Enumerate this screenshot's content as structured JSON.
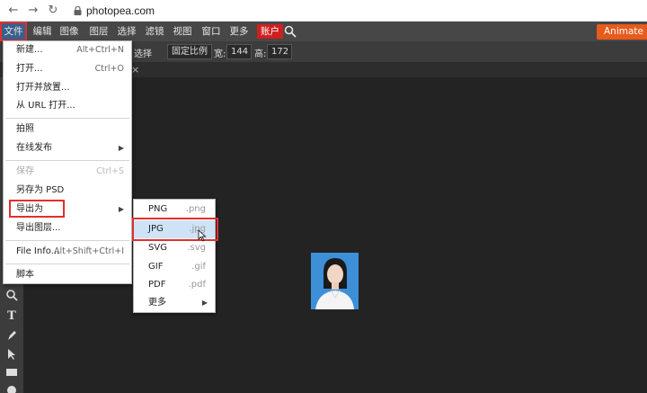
{
  "browser": {
    "url": "photopea.com",
    "back_icon": "arrow-left-icon",
    "forward_icon": "arrow-right-icon",
    "reload_icon": "reload-icon"
  },
  "menubar": {
    "items": [
      "文件",
      "编辑",
      "图像",
      "图层",
      "选择",
      "滤镜",
      "视图",
      "窗口",
      "更多"
    ],
    "account": "账户",
    "animate_button": "Animate"
  },
  "options": {
    "select_label": "选择",
    "ratio_select": "固定比例",
    "width_label": "宽:",
    "width_value": "144",
    "height_label": "高:",
    "height_value": "172"
  },
  "file_menu": {
    "new": "新建...",
    "new_shortcut": "Alt+Ctrl+N",
    "open": "打开...",
    "open_shortcut": "Ctrl+O",
    "open_place": "打开并放置...",
    "open_url": "从 URL 打开...",
    "capture": "拍照",
    "publish_online": "在线发布",
    "save": "保存",
    "save_shortcut": "Ctrl+S",
    "save_as_psd": "另存为 PSD",
    "export_as": "导出为",
    "export_layers": "导出图层...",
    "file_info": "File Info...",
    "file_info_shortcut": "Alt+Shift+Ctrl+I",
    "script": "脚本"
  },
  "export_submenu": {
    "items": [
      {
        "label": "PNG",
        "ext": ".png"
      },
      {
        "label": "JPG",
        "ext": ".jpg"
      },
      {
        "label": "SVG",
        "ext": ".svg"
      },
      {
        "label": "GIF",
        "ext": ".gif"
      },
      {
        "label": "PDF",
        "ext": ".pdf"
      }
    ],
    "more": "更多"
  },
  "colors": {
    "accent_red": "#e03030",
    "menu_bg": "#474747",
    "canvas_bg": "#232323",
    "selected_bg": "#cfe3f7",
    "animate_orange": "#e85b1c"
  }
}
